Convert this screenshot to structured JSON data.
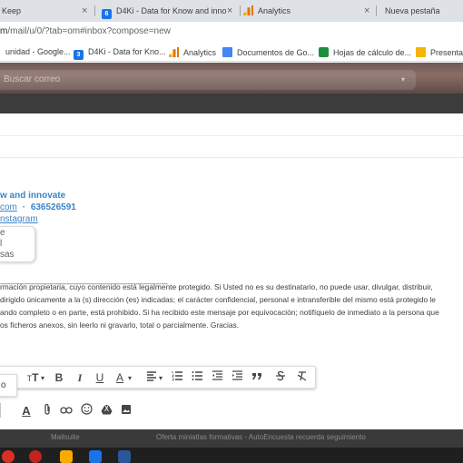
{
  "browser": {
    "tabs": [
      {
        "label": "Keep"
      },
      {
        "label": "D4Ki - Data for Know and inno",
        "badge": "6"
      },
      {
        "label": "Analytics"
      },
      {
        "label": "Nueva pestaña"
      }
    ],
    "close_glyph": "×",
    "url_prefix": "m",
    "url_rest": "/mail/u/0/?tab=om#inbox?compose=new",
    "bookmarks": [
      {
        "label": "unidad - Google..."
      },
      {
        "label": "D4Ki - Data for Kno...",
        "badge": "3"
      },
      {
        "label": "Analytics"
      },
      {
        "label": "Documentos de Go..."
      },
      {
        "label": "Hojas de cálculo de..."
      },
      {
        "label": "Presentac"
      }
    ]
  },
  "gmail": {
    "search_placeholder": "Buscar correo",
    "search_caret": "▾"
  },
  "signature": {
    "name": "w and innovate",
    "email": "com",
    "separator": "·",
    "phone": "636526591",
    "instagram": "nstagram",
    "box_lines": [
      "e",
      "l",
      "sas"
    ]
  },
  "body": {
    "dashes": "-----------------------------------------------------------------------------------------------",
    "disclaimer": [
      "rmación propietaria, cuyo contenido está legalmente protegido. Si Usted no es su destinatario, no puede usar, divulgar, distribuir,",
      "dirigido únicamente a la (s) dirección (es) indicadas; el carácter confidencial, personal e intransferible del mismo está protegido le",
      "ando completo o en  parte, está prohibido. Si ha recibido este mensaje por equivocación; notifíquelo de inmediato a la persona que",
      "os ficheros anexos, sin leerlo ni gravarlo, total o parcialmente. Gracias."
    ]
  },
  "formatting_toolbar": {
    "popup_label": "o",
    "font_size_icon": "T",
    "caret": "▾",
    "bold": "B",
    "italic": "I",
    "underline": "U",
    "text_color": "A"
  },
  "compose_actions": {
    "text_color": "A"
  },
  "background_text": {
    "left": "Mailsuite",
    "right": "Oferta miniatlas formativas - AutoEncuesta recuerda seguimiento"
  },
  "colors": {
    "signature_blue": "#3d85c6",
    "tab_strip": "#dee1e6",
    "header_theme": "#7a6260"
  }
}
